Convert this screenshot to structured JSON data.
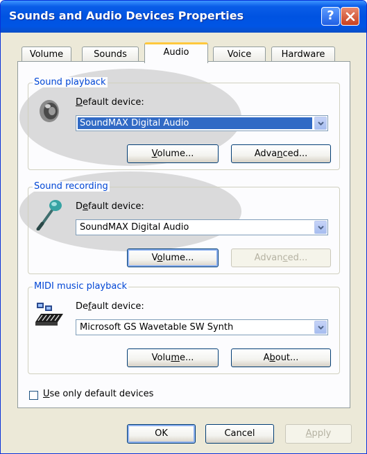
{
  "window": {
    "title": "Sounds and Audio Devices Properties",
    "help_glyph": "?"
  },
  "tabs": [
    {
      "label": "Volume",
      "active": false
    },
    {
      "label": "Sounds",
      "active": false
    },
    {
      "label": "Audio",
      "active": true
    },
    {
      "label": "Voice",
      "active": false
    },
    {
      "label": "Hardware",
      "active": false
    }
  ],
  "playback": {
    "title": "Sound playback",
    "default_label": {
      "pre": "",
      "key": "D",
      "post": "efault device:"
    },
    "device": "SoundMAX Digital Audio",
    "volume_button": {
      "pre": "",
      "key": "V",
      "post": "olume..."
    },
    "advanced_button": {
      "pre": "Adva",
      "key": "n",
      "post": "ced..."
    }
  },
  "recording": {
    "title": "Sound recording",
    "default_label": {
      "pre": "D",
      "key": "e",
      "post": "fault device:"
    },
    "device": "SoundMAX Digital Audio",
    "volume_button": {
      "pre": "V",
      "key": "o",
      "post": "lume..."
    },
    "advanced_button": {
      "pre": "Advan",
      "key": "c",
      "post": "ed..."
    }
  },
  "midi": {
    "title": "MIDI music playback",
    "default_label": {
      "pre": "De",
      "key": "f",
      "post": "ault device:"
    },
    "device": "Microsoft GS Wavetable SW Synth",
    "volume_button": {
      "pre": "Volu",
      "key": "m",
      "post": "e..."
    },
    "about_button": {
      "pre": "A",
      "key": "b",
      "post": "out..."
    }
  },
  "use_default_checkbox": {
    "pre": "",
    "key": "U",
    "post": "se only default devices",
    "checked": false
  },
  "dialog_buttons": {
    "ok": "OK",
    "cancel": "Cancel",
    "apply": {
      "pre": "",
      "key": "A",
      "post": "pply"
    }
  },
  "colors": {
    "titlebar": "#0053e1",
    "group_title": "#0046d5",
    "selection": "#316ac5",
    "active_tab_accent": "#ffc83c"
  }
}
